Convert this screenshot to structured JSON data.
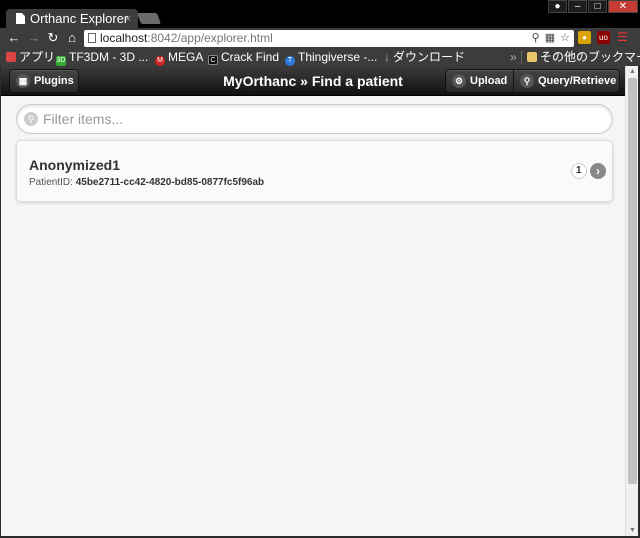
{
  "browser": {
    "tab_title": "Orthanc Explorer",
    "tab_close": "×",
    "url_host": "localhost",
    "url_rest": ":8042/app/explorer.html",
    "window_buttons": {
      "min": "–",
      "max": "□",
      "close": "✕"
    }
  },
  "bookmarks": {
    "apps": "アプリ",
    "items": [
      "TF3DM - 3D ...",
      "MEGA",
      "Crack Find",
      "Thingiverse -...",
      "ダウンロード"
    ],
    "overflow": "»",
    "other": "その他のブックマーク"
  },
  "header": {
    "plugins_label": "Plugins",
    "title": "MyOrthanc » Find a patient",
    "upload_label": "Upload",
    "query_label": "Query/Retrieve"
  },
  "filter": {
    "placeholder": "Filter items..."
  },
  "patients": [
    {
      "name": "Anonymized1",
      "id_label": "PatientID:",
      "id_value": "45be2711-cc42-4820-bd85-0877fc5f96ab",
      "count": "1"
    }
  ],
  "colors": {
    "header_bg": "#1e1e1e",
    "page_bg": "#f5f5f5",
    "browser_chrome": "#3c3c3c"
  }
}
